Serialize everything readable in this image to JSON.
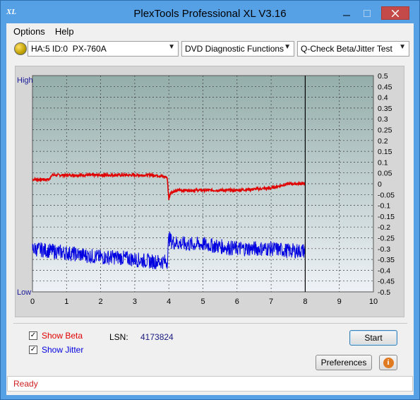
{
  "window": {
    "title": "PlexTools Professional XL V3.16",
    "icon_text": "XL"
  },
  "menu": [
    {
      "label": "Options"
    },
    {
      "label": "Help"
    }
  ],
  "toolbar": {
    "drive": "HA:5 ID:0  PX-760A",
    "function": "DVD Diagnostic Functions",
    "test": "Q-Check Beta/Jitter Test"
  },
  "chart_data": {
    "type": "line",
    "left_labels": {
      "high": "High",
      "low": "Low"
    },
    "x_ticks": [
      "0",
      "1",
      "2",
      "3",
      "4",
      "5",
      "6",
      "7",
      "8",
      "9",
      "10"
    ],
    "y_ticks": [
      "0.5",
      "0.45",
      "0.4",
      "0.35",
      "0.3",
      "0.25",
      "0.2",
      "0.15",
      "0.1",
      "0.05",
      "0",
      "-0.05",
      "-0.1",
      "-0.15",
      "-0.2",
      "-0.25",
      "-0.3",
      "-0.35",
      "-0.4",
      "-0.45",
      "-0.5"
    ],
    "xlim": [
      0,
      10
    ],
    "ylim": [
      -0.5,
      0.5
    ],
    "end_marker_x": 8,
    "series": [
      {
        "color": "#e00000",
        "x": [
          0,
          0.5,
          0.55,
          1,
          2,
          3,
          3.6,
          3.95,
          4.0,
          4.05,
          4.3,
          5,
          6,
          7,
          7.5,
          8
        ],
        "y": [
          0.02,
          0.02,
          0.04,
          0.04,
          0.04,
          0.04,
          0.04,
          0.03,
          -0.07,
          -0.04,
          -0.03,
          -0.03,
          -0.03,
          -0.02,
          0.0,
          0.0
        ]
      },
      {
        "color": "#0000e0",
        "x": [
          0,
          0.5,
          1,
          1.5,
          2,
          2.5,
          3,
          3.5,
          3.95,
          4.0,
          4.1,
          4.5,
          5,
          5.5,
          6,
          6.5,
          7,
          7.5,
          8
        ],
        "y": [
          -0.3,
          -0.31,
          -0.32,
          -0.33,
          -0.34,
          -0.34,
          -0.35,
          -0.36,
          -0.36,
          -0.25,
          -0.27,
          -0.28,
          -0.28,
          -0.29,
          -0.3,
          -0.3,
          -0.3,
          -0.31,
          -0.31
        ]
      }
    ]
  },
  "controls": {
    "show_beta": "Show Beta",
    "show_jitter": "Show Jitter",
    "lsn_label": "LSN:",
    "lsn_value": "4173824",
    "start": "Start",
    "preferences": "Preferences"
  },
  "status": "Ready",
  "colors": {
    "beta": "#e00000",
    "jitter": "#0000e0"
  }
}
